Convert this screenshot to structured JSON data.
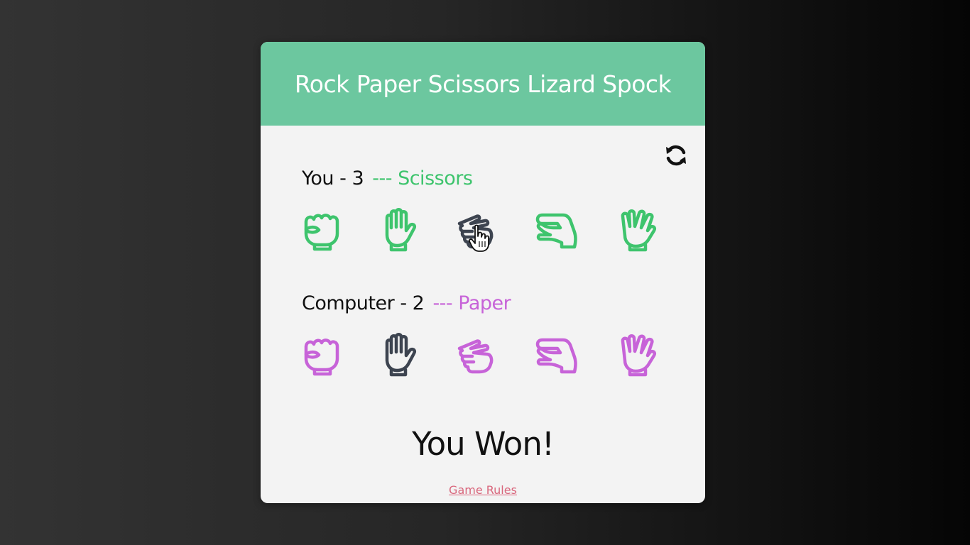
{
  "game": {
    "title": "Rock Paper Scissors Lizard Spock",
    "result": "You Won!",
    "rules_link": "Game Rules"
  },
  "colors": {
    "header": "#6cc79f",
    "player": "#3ec46d",
    "computer": "#c763d8",
    "selected": "#3d4450",
    "rules_link": "#d9667c"
  },
  "player": {
    "name": "You",
    "dash": " - ",
    "score": "3",
    "separator": "---",
    "choice": "Scissors",
    "selected_index": 2
  },
  "computer": {
    "name": "Computer",
    "dash": " - ",
    "score": "2",
    "separator": "---",
    "choice": "Paper",
    "selected_index": 1
  },
  "choices": [
    "rock",
    "paper",
    "scissors",
    "lizard",
    "spock"
  ],
  "icons": {
    "refresh": "refresh-icon",
    "hand_rock": "hand-rock-icon",
    "hand_paper": "hand-paper-icon",
    "hand_scissors": "hand-scissors-icon",
    "hand_lizard": "hand-lizard-icon",
    "hand_spock": "hand-spock-icon",
    "cursor": "pointer-hand-cursor-icon"
  }
}
